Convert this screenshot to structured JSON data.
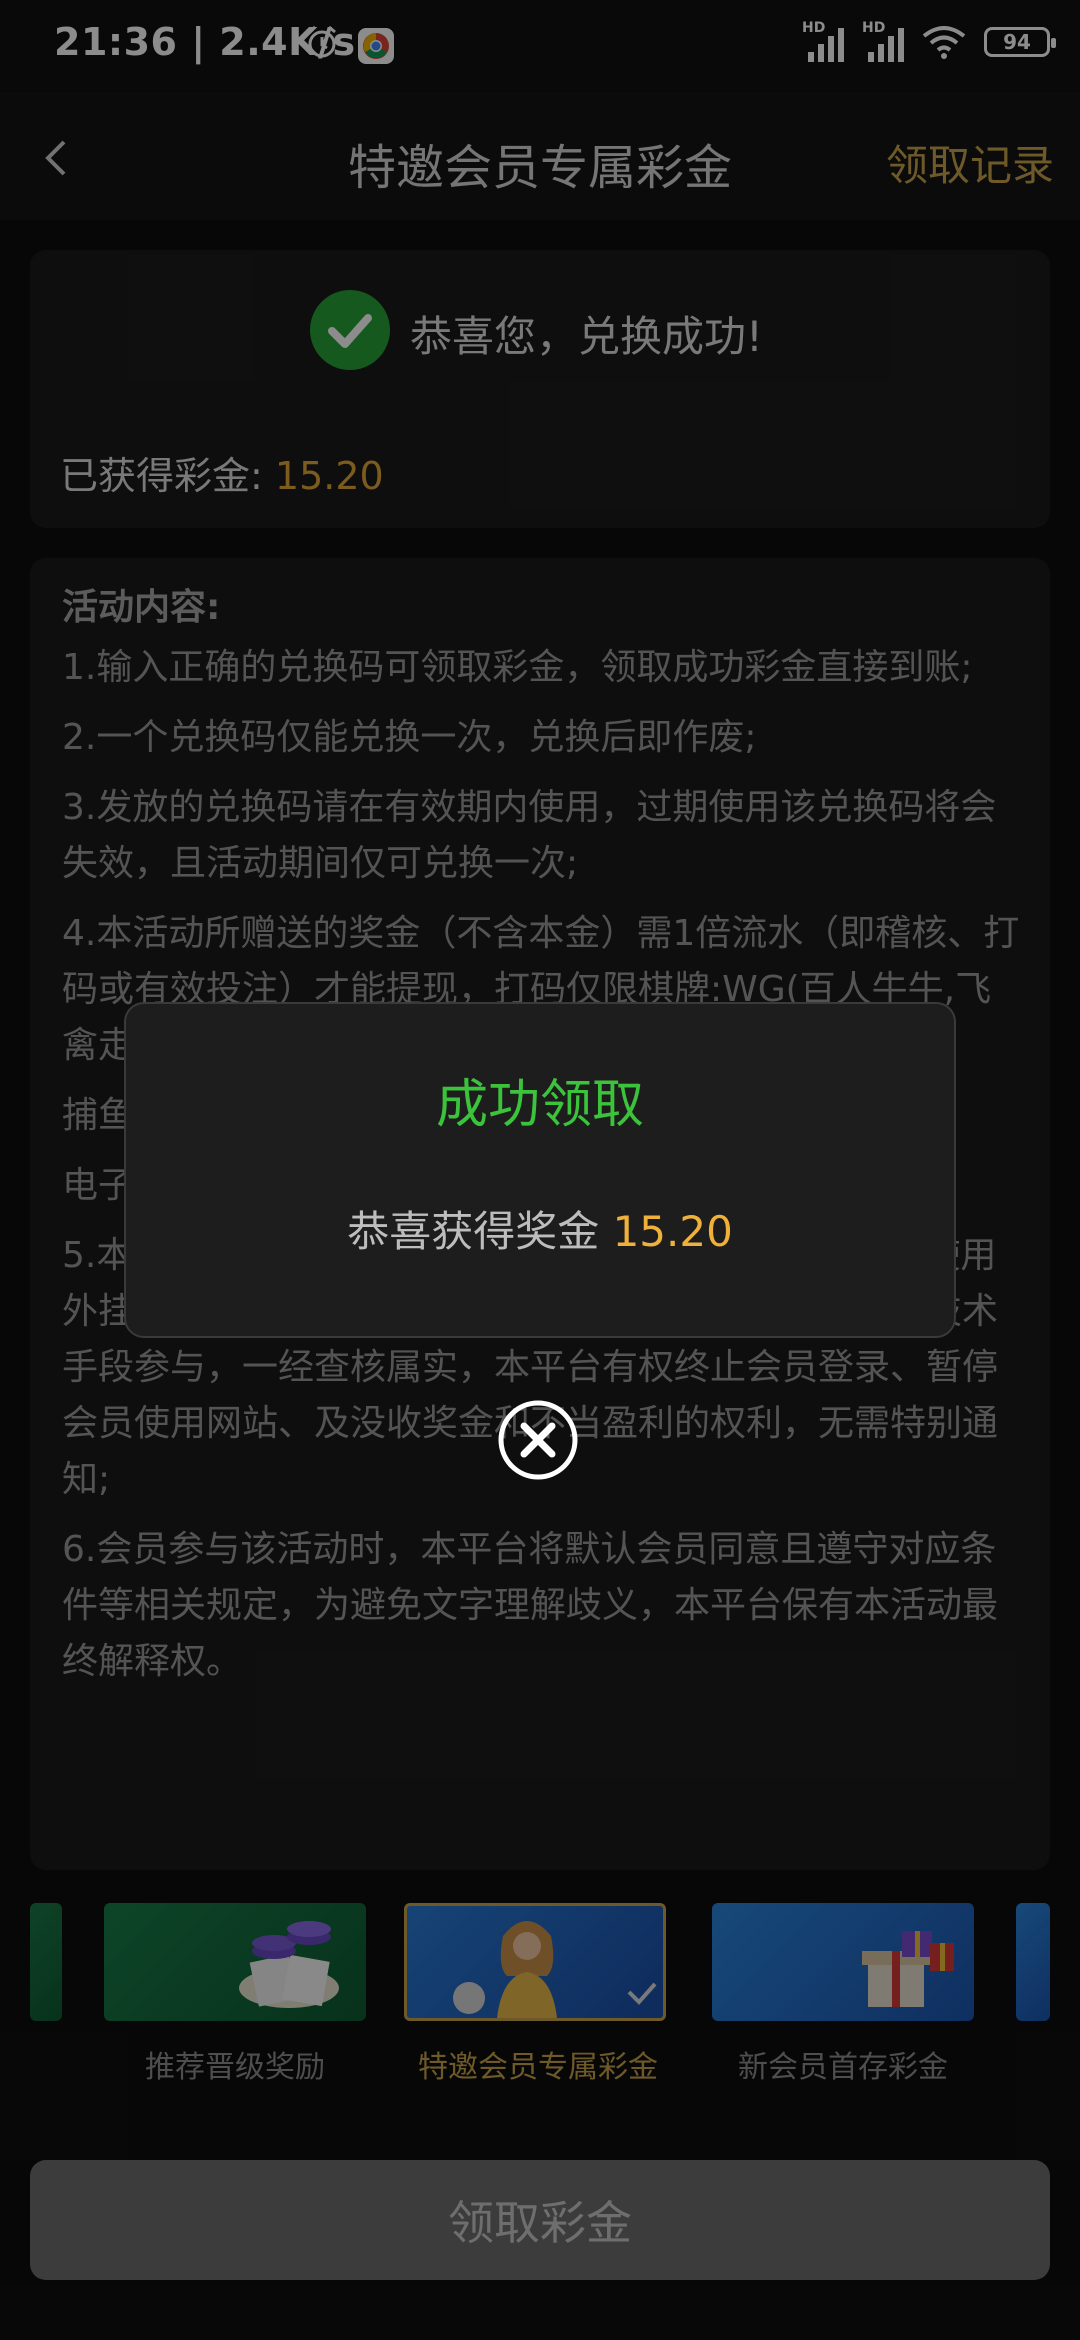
{
  "status_bar": {
    "time": "21:36 | 2.4K/s",
    "battery": "94",
    "hd1": "HD",
    "hd2": "HD"
  },
  "nav": {
    "title": "特邀会员专属彩金",
    "right_action": "领取记录"
  },
  "success": {
    "message": "恭喜您，兑换成功!",
    "earned_label": "已获得彩金:",
    "earned_value": "15.20"
  },
  "rules": {
    "heading": "活动内容:",
    "items": [
      "1.输入正确的兑换码可领取彩金，领取成功彩金直接到账;",
      "2.一个兑换码仅能兑换一次，兑换后即作废;",
      "3.发放的兑换码请在有效期内使用，过期使用该兑换码将会失效，且活动期间仅可兑换一次;",
      "4.本活动所赠送的奖金（不含本金）需1倍流水（即稽核、打码或有效投注）才能提现，打码仅限棋牌:WG(百人牛牛,飞禽走兽... 斗地主, 牛牛, 看牌... 二人麻将)",
      "捕鱼",
      "电子",
      "5.本活动仅限账号本人领取奖励，禁止租借账号，不得使用外挂程式、机器人、利用协议漏洞、接口、群控或其他技术手段参与，一经查核属实，本平台有权终止会员登录、暂停会员使用网站、及没收奖金和不当盈利的权利，无需特别通知;",
      "6.会员参与该活动时，本平台将默认会员同意且遵守对应条件等相关规定，为避免文字理解歧义，本平台保有本活动最终解释权。"
    ]
  },
  "carousel": {
    "items": [
      {
        "label": "推荐晋级奖励",
        "selected": false
      },
      {
        "label": "特邀会员专属彩金",
        "selected": true
      },
      {
        "label": "新会员首存彩金",
        "selected": false
      }
    ]
  },
  "claim_button": "领取彩金",
  "modal": {
    "title": "成功领取",
    "message": "恭喜获得奖金",
    "amount": "15.20"
  },
  "colors": {
    "accent_gold": "#c9a44a",
    "amount_orange": "#f0b13a",
    "success_green": "#3cc33c"
  }
}
